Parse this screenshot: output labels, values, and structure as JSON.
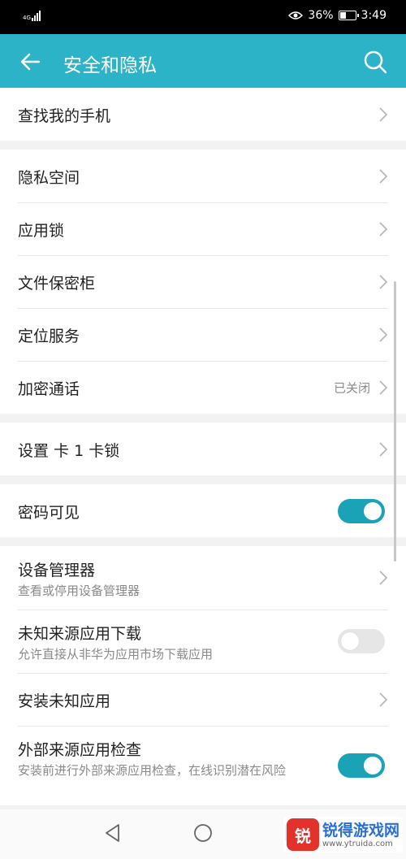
{
  "status_bar": {
    "network": "4G",
    "battery": "36%",
    "battery_level": 0.36,
    "time": "3:49",
    "icons": [
      "signal-icon",
      "eye-icon",
      "battery-icon"
    ]
  },
  "header": {
    "title": "安全和隐私",
    "back_icon": "arrow-left-icon",
    "search_icon": "search-icon"
  },
  "groups": {
    "find": {
      "items": [
        {
          "label": "查找我的手机"
        }
      ]
    },
    "privacy": {
      "items": [
        {
          "label": "隐私空间"
        },
        {
          "label": "应用锁"
        },
        {
          "label": "文件保密柜"
        },
        {
          "label": "定位服务"
        },
        {
          "label": "加密通话",
          "value": "已关闭"
        }
      ]
    },
    "sim": {
      "items": [
        {
          "label": "设置 卡 1 卡锁"
        }
      ]
    },
    "password": {
      "items": [
        {
          "label": "密码可见",
          "toggle_on": true
        }
      ]
    },
    "device": {
      "items": [
        {
          "label": "设备管理器",
          "sub": "查看或停用设备管理器"
        },
        {
          "label": "未知来源应用下载",
          "sub": "允许直接从非华为应用市场下载应用",
          "toggle_on": false
        },
        {
          "label": "安装未知应用"
        },
        {
          "label": "外部来源应用检查",
          "sub": "安装前进行外部来源应用检查，在线识别潜在风险",
          "toggle_on": true
        }
      ]
    }
  },
  "nav_bar": {
    "icons": [
      "nav-back-icon",
      "nav-home-icon",
      "nav-recent-icon"
    ]
  },
  "watermark": {
    "logo": "锐",
    "name": "锐得游戏网",
    "url": "www.ytruida.com"
  },
  "colors": {
    "accent": "#2cb3c8",
    "toggle_on": "#1aa3b6",
    "toggle_off": "#e6e6e6",
    "background": "#f2f2f2"
  }
}
